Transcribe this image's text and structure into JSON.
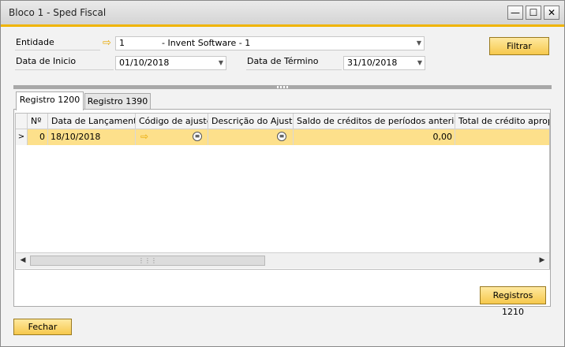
{
  "window": {
    "title": "Bloco 1 - Sped Fiscal",
    "minimize": "—",
    "maximize": "☐",
    "close": "✕"
  },
  "form": {
    "entidade_label": "Entidade",
    "entidade_code": "1",
    "entidade_name": "- Invent Software - 1",
    "data_inicio_label": "Data de Inicio",
    "data_inicio_value": "01/10/2018",
    "data_termino_label": "Data de Término",
    "data_termino_value": "31/10/2018",
    "filtrar_label": "Filtrar"
  },
  "tabs": [
    {
      "label": "Registro 1200",
      "active": true
    },
    {
      "label": "Registro 1390",
      "active": false
    }
  ],
  "grid": {
    "columns": [
      "Nº",
      "Data de Lançamento",
      "Código de ajuste",
      "Descrição do Ajuste",
      "Saldo de créditos de períodos anteriores",
      "Total de crédito apropria"
    ],
    "rows": [
      {
        "n": "0",
        "data": "18/10/2018",
        "codigo": "",
        "descricao": "",
        "saldo": "0,00",
        "total": ""
      }
    ]
  },
  "buttons": {
    "registros_1210": "Registros 1210",
    "fechar": "Fechar"
  },
  "colors": {
    "accent": "#f0b400",
    "selected_row": "#fde08b",
    "button_yellow": "#f6c84c"
  }
}
